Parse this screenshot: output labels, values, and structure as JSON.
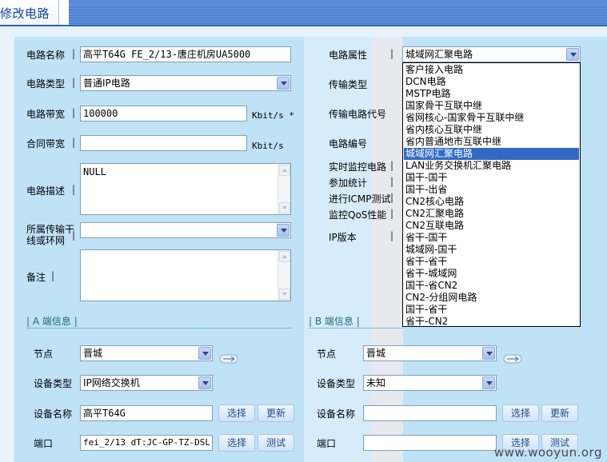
{
  "page": {
    "title": "修改电路"
  },
  "colors": {
    "title_text": "#1346a5",
    "selected_bg": "#316ac5",
    "panel_bg": "#bfe2f7"
  },
  "circuit": {
    "name_label": "电路名称",
    "name_value": "高平T64G FE_2/13-唐庄机房UA5000",
    "type_label": "电路类型",
    "type_value": "普通IP电路",
    "bandwidth_label": "电路带宽",
    "bandwidth_value": "100000",
    "bandwidth_unit": "Kbit/s *",
    "contract_label": "合同带宽",
    "contract_value": "",
    "contract_unit": "Kbit/s",
    "desc_label": "电路描述",
    "desc_value": "NULL",
    "trunk_label_line1": "所属传输干",
    "trunk_label_line2": "线或环网",
    "trunk_value": "",
    "remark_label": "备注",
    "remark_value": ""
  },
  "right_labels": {
    "attribute": "电路属性",
    "attribute_value": "城域网汇聚电路",
    "transport_type": "传输类型",
    "transport_code": "传输电路代号",
    "circuit_code": "电路编号",
    "realtime_monitor": "实时监控电路",
    "join_stats": "参加统计",
    "icmp_test": "进行ICMP测试",
    "qos_monitor": "监控QoS性能",
    "ip_version": "IP版本"
  },
  "attribute_options": [
    "客户接入电路",
    "DCN电路",
    "MSTP电路",
    "国家骨干互联中继",
    "省网核心-国家骨干互联中继",
    "省内核心互联中继",
    "省内普通地市互联中继",
    "城域网汇聚电路",
    "LAN业务交换机汇聚电路",
    "国干-国干",
    "国干-出省",
    "CN2核心电路",
    "CN2汇聚电路",
    "CN2互联电路",
    "省干-国干",
    "城域网-国干",
    "省干-省干",
    "省干-城域网",
    "国干-省CN2",
    "CN2-分组网电路",
    "国干-省干",
    "省干-CN2"
  ],
  "selected_option_index": 7,
  "end_a": {
    "header": "| A 端信息 |",
    "node_label": "节点",
    "node_value": "晋城",
    "device_type_label": "设备类型",
    "device_type_value": "IP网络交换机",
    "device_name_label": "设备名称",
    "device_name_value": "高平T64G",
    "port_label": "端口",
    "port_value": "fei_2/13 dT:JC-GP-TZ-DSL"
  },
  "end_b": {
    "header": "| B 端信息 |",
    "node_label": "节点",
    "node_value": "晋城",
    "device_type_label": "设备类型",
    "device_type_value": "未知",
    "device_name_label": "设备名称",
    "device_name_value": "",
    "port_label": "端口",
    "port_value": ""
  },
  "buttons": {
    "select": "选择",
    "update": "更新",
    "test": "测试"
  },
  "watermark": "www.wooyun.org"
}
